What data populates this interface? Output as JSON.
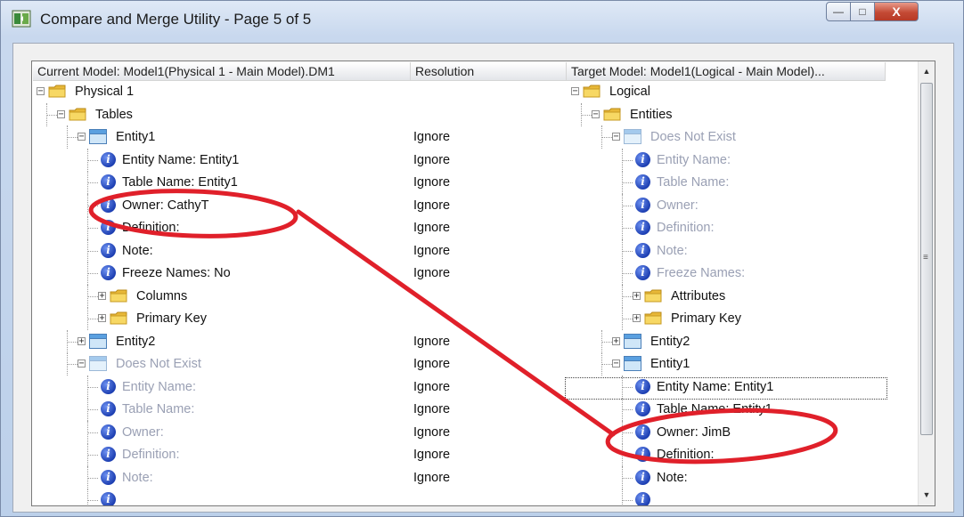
{
  "window": {
    "title": "Compare and Merge Utility  - Page 5 of 5",
    "min_glyph": "—",
    "max_glyph": "□",
    "close_glyph": "X"
  },
  "columns": {
    "current": "Current Model: Model1(Physical 1 - Main Model).DM1",
    "resolution": "Resolution",
    "target": "Target Model: Model1(Logical - Main Model)..."
  },
  "left_tree": [
    {
      "label": "Physical 1",
      "icon": "folder-icon",
      "expander": "−",
      "gray": false,
      "resolution": ""
    },
    {
      "label": "Tables",
      "icon": "folder-icon",
      "expander": "−",
      "gray": false,
      "resolution": ""
    },
    {
      "label": "Entity1",
      "icon": "table-icon",
      "expander": "−",
      "gray": false,
      "resolution": "Ignore"
    },
    {
      "label": "Entity Name: Entity1",
      "icon": "info-icon",
      "gray": false,
      "resolution": "Ignore"
    },
    {
      "label": "Table Name: Entity1",
      "icon": "info-icon",
      "gray": false,
      "resolution": "Ignore"
    },
    {
      "label": "Owner: CathyT",
      "icon": "info-icon",
      "gray": false,
      "resolution": "Ignore"
    },
    {
      "label": "Definition:",
      "icon": "info-icon",
      "gray": false,
      "resolution": "Ignore"
    },
    {
      "label": "Note:",
      "icon": "info-icon",
      "gray": false,
      "resolution": "Ignore"
    },
    {
      "label": "Freeze Names: No",
      "icon": "info-icon",
      "gray": false,
      "resolution": "Ignore"
    },
    {
      "label": "Columns",
      "icon": "folder-icon",
      "expander": "+",
      "gray": false,
      "resolution": ""
    },
    {
      "label": "Primary Key",
      "icon": "folder-icon",
      "expander": "+",
      "gray": false,
      "resolution": ""
    },
    {
      "label": "Entity2",
      "icon": "table-icon",
      "expander": "+",
      "gray": false,
      "resolution": "Ignore"
    },
    {
      "label": "Does Not Exist",
      "icon": "table-icon",
      "expander": "−",
      "gray": true,
      "resolution": "Ignore"
    },
    {
      "label": "Entity Name:",
      "icon": "info-icon",
      "gray": true,
      "resolution": "Ignore"
    },
    {
      "label": "Table Name:",
      "icon": "info-icon",
      "gray": true,
      "resolution": "Ignore"
    },
    {
      "label": "Owner:",
      "icon": "info-icon",
      "gray": true,
      "resolution": "Ignore"
    },
    {
      "label": "Definition:",
      "icon": "info-icon",
      "gray": true,
      "resolution": "Ignore"
    },
    {
      "label": "Note:",
      "icon": "info-icon",
      "gray": true,
      "resolution": "Ignore"
    },
    {
      "label": "",
      "icon": "info-icon",
      "gray": true,
      "resolution": ""
    }
  ],
  "right_tree": [
    {
      "label": "Logical",
      "icon": "folder-icon",
      "expander": "−",
      "gray": false
    },
    {
      "label": "Entities",
      "icon": "folder-icon",
      "expander": "−",
      "gray": false
    },
    {
      "label": "Does Not Exist",
      "icon": "table-icon",
      "expander": "−",
      "gray": true
    },
    {
      "label": "Entity Name:",
      "icon": "info-icon",
      "gray": true
    },
    {
      "label": "Table Name:",
      "icon": "info-icon",
      "gray": true
    },
    {
      "label": "Owner:",
      "icon": "info-icon",
      "gray": true
    },
    {
      "label": "Definition:",
      "icon": "info-icon",
      "gray": true
    },
    {
      "label": "Note:",
      "icon": "info-icon",
      "gray": true
    },
    {
      "label": "Freeze Names:",
      "icon": "info-icon",
      "gray": true
    },
    {
      "label": "Attributes",
      "icon": "folder-icon",
      "expander": "+",
      "gray": false
    },
    {
      "label": "Primary Key",
      "icon": "folder-icon",
      "expander": "+",
      "gray": false
    },
    {
      "label": "Entity2",
      "icon": "table-icon",
      "expander": "+",
      "gray": false
    },
    {
      "label": "Entity1",
      "icon": "table-icon",
      "expander": "−",
      "gray": false
    },
    {
      "label": "Entity Name: Entity1",
      "icon": "info-icon",
      "gray": false
    },
    {
      "label": "Table Name: Entity1",
      "icon": "info-icon",
      "gray": false
    },
    {
      "label": "Owner: JimB",
      "icon": "info-icon",
      "gray": false
    },
    {
      "label": "Definition:",
      "icon": "info-icon",
      "gray": false
    },
    {
      "label": "Note:",
      "icon": "info-icon",
      "gray": false
    },
    {
      "label": "",
      "icon": "info-icon",
      "gray": false
    }
  ],
  "scrollbar": {
    "up": "▲",
    "down": "▼",
    "grip": "≡"
  },
  "colors": {
    "annotation": "#e0202a",
    "gray_text": "#9aa0b4",
    "info_icon": "#1d3fb2",
    "folder": "#f2cd4c"
  }
}
